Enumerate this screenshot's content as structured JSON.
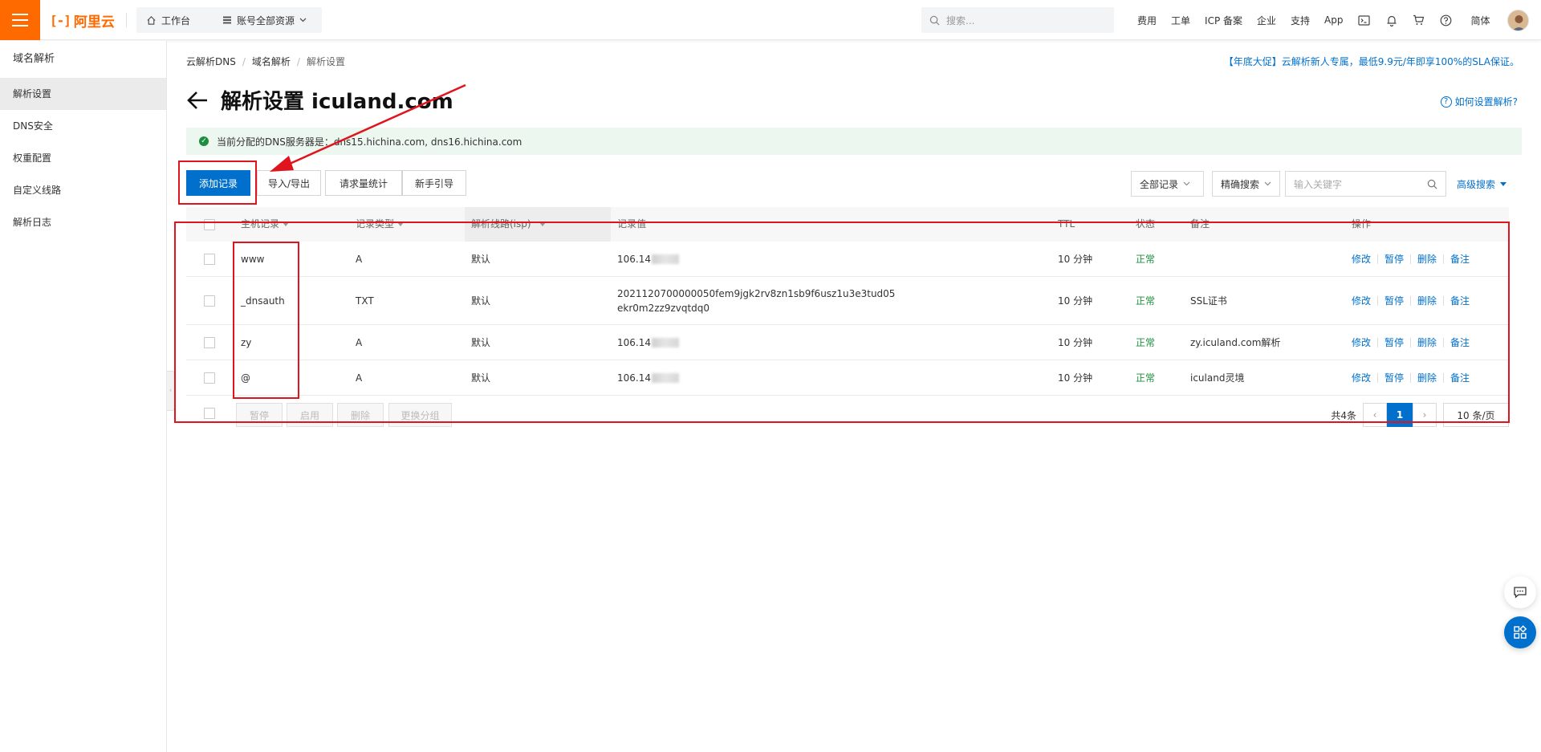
{
  "topbar": {
    "logo_text": "阿里云",
    "workbench": "工作台",
    "resources": "账号全部资源",
    "search_placeholder": "搜索...",
    "nav": [
      "费用",
      "工单",
      "ICP 备案",
      "企业",
      "支持",
      "App"
    ],
    "lang": "简体"
  },
  "sidebar": {
    "title": "域名解析",
    "items": [
      "解析设置",
      "DNS安全",
      "权重配置",
      "自定义线路",
      "解析日志"
    ],
    "active_index": 0
  },
  "breadcrumb": [
    "云解析DNS",
    "域名解析",
    "解析设置"
  ],
  "promo": "【年底大促】云解析新人专属，最低9.9元/年即享100%的SLA保证。",
  "page_title": "解析设置 iculand.com",
  "help_link": "如何设置解析?",
  "notice": "当前分配的DNS服务器是：dns15.hichina.com, dns16.hichina.com",
  "toolbar": {
    "add": "添加记录",
    "import_export": "导入/导出",
    "stats": "请求量统计",
    "guide": "新手引导",
    "filter_all": "全部记录",
    "filter_exact": "精确搜索",
    "keyword_placeholder": "输入关键字",
    "advanced": "高级搜索"
  },
  "table": {
    "headers": [
      "主机记录",
      "记录类型",
      "解析线路(isp)",
      "记录值",
      "TTL",
      "状态",
      "备注",
      "操作"
    ],
    "rows": [
      {
        "host": "www",
        "type": "A",
        "line": "默认",
        "value": "106.14",
        "value2": "",
        "ttl": "10 分钟",
        "status": "正常",
        "note": ""
      },
      {
        "host": "_dnsauth",
        "type": "TXT",
        "line": "默认",
        "value": "2021120700000050fem9jgk2rv8zn1sb9f6usz1u3e3tud05",
        "value2": "ekr0m2zz9zvqtdq0",
        "ttl": "10 分钟",
        "status": "正常",
        "note": "SSL证书"
      },
      {
        "host": "zy",
        "type": "A",
        "line": "默认",
        "value": "106.14",
        "value2": "",
        "ttl": "10 分钟",
        "status": "正常",
        "note": "zy.iculand.com解析"
      },
      {
        "host": "@",
        "type": "A",
        "line": "默认",
        "value": "106.14",
        "value2": "",
        "ttl": "10 分钟",
        "status": "正常",
        "note": "iculand灵境"
      }
    ],
    "ops": [
      "修改",
      "暂停",
      "删除",
      "备注"
    ],
    "footer_buttons": [
      "暂停",
      "启用",
      "删除",
      "更换分组"
    ],
    "total": "共4条",
    "page": "1",
    "page_size": "10 条/页"
  },
  "colors": {
    "brand_orange": "#ff6a00",
    "primary_blue": "#0070cc",
    "status_green": "#1e8e3e",
    "annotation_red": "#e0141e"
  }
}
